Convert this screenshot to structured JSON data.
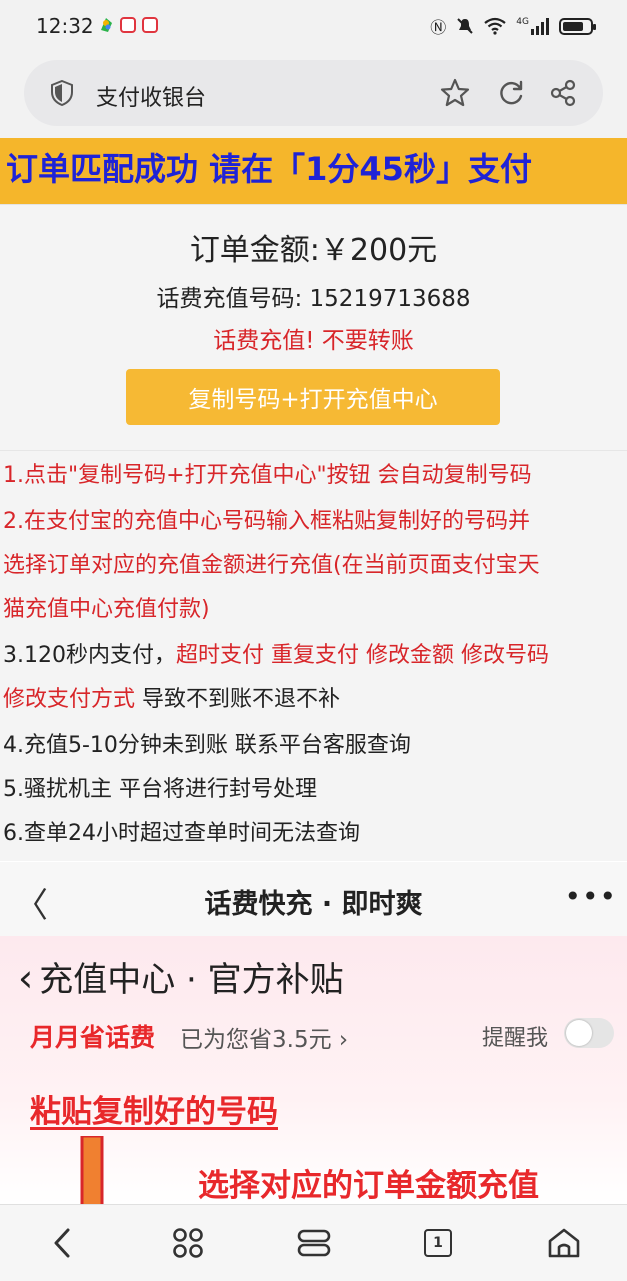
{
  "status_bar": {
    "time": "12:32",
    "signal_label": "4G"
  },
  "url_bar": {
    "title": "支付收银台",
    "icons": [
      "shield-icon",
      "star-icon",
      "refresh-icon",
      "share-icon"
    ]
  },
  "banner": {
    "text": "订单匹配成功 请在「1分45秒」支付",
    "bg_color": "#f5b62b",
    "text_color": "#1f23d6"
  },
  "order": {
    "amount_label": "订单金额:￥200元",
    "phone_line": "话费充值号码:  15219713688",
    "warning": "话费充值! 不要转账",
    "copy_button": "复制号码+打开充值中心"
  },
  "instructions": {
    "l1": "1.点击\"复制号码+打开充值中心\"按钮 会自动复制号码",
    "l2": "2.在支付宝的充值中心号码输入框粘贴复制好的号码并",
    "l3": "选择订单对应的充值金额进行充值(在当前页面支付宝天",
    "l4": "猫充值中心充值付款)",
    "l5_a": "3.120秒内支付，",
    "l5_b": "超时支付 重复支付 修改金额 修改号码",
    "l6_a": "修改支付方式",
    "l6_b": " 导致不到账不退不补",
    "l7": "4.充值5-10分钟未到账 联系平台客服查询",
    "l8": "5.骚扰机主 平台将进行封号处理",
    "l9": "6.查单24小时超过查单时间无法查询"
  },
  "demo": {
    "back": "〈",
    "title": "话费快充 · 即时爽",
    "more": "•••",
    "heading": "充值中心 · 官方补贴",
    "save_label": "月月省话费",
    "saved_text": "已为您省3.5元 ›",
    "remind_label": "提醒我",
    "paste_text": "粘贴复制好的号码",
    "choose_text": "选择对应的订单金额充值"
  },
  "nav_bar": {
    "tabs_count": "1",
    "icons": [
      "back-icon",
      "apps-icon",
      "menu-icon",
      "tabs-icon",
      "home-icon"
    ]
  }
}
